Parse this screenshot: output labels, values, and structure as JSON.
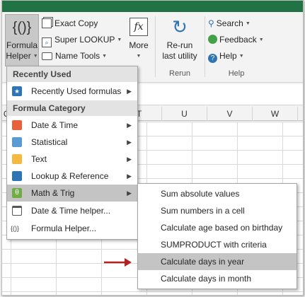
{
  "ribbon": {
    "formula_helper": {
      "line1": "Formula",
      "line2": "Helper",
      "icon": "{()}"
    },
    "exact_copy": "Exact Copy",
    "super_lookup": "Super LOOKUP",
    "name_tools": "Name Tools",
    "more": {
      "label": "More",
      "icon": "fx"
    },
    "rerun": {
      "line1": "Re-run",
      "line2": "last utility"
    },
    "search": "Search",
    "feedback": "Feedback",
    "help": "Help",
    "group_rerun": "Rerun",
    "group_help": "Help"
  },
  "columns": [
    "Q",
    "T",
    "U",
    "V",
    "W"
  ],
  "menu": {
    "recently_used_header": "Recently Used",
    "recently_used_item": "Recently Used formulas",
    "category_header": "Formula Category",
    "items": [
      {
        "label": "Date & Time",
        "icon": "clock-icon",
        "color": "#e8603c"
      },
      {
        "label": "Statistical",
        "icon": "chart-icon",
        "color": "#5b9bd5"
      },
      {
        "label": "Text",
        "icon": "text-icon",
        "color": "#f4b942"
      },
      {
        "label": "Lookup & Reference",
        "icon": "lookup-icon",
        "color": "#2e75b6"
      },
      {
        "label": "Math & Trig",
        "icon": "theta-icon",
        "color": "#70ad47"
      },
      {
        "label": "Date & Time helper...",
        "icon": "calendar-icon",
        "color": "#555555"
      },
      {
        "label": "Formula Helper...",
        "icon": "{()}",
        "color": "#555555"
      }
    ]
  },
  "submenu": {
    "items": [
      "Sum absolute values",
      "Sum numbers in a cell",
      "Calculate age based on birthday",
      "SUMPRODUCT with criteria",
      "Calculate days in year",
      "Calculate days in month"
    ],
    "highlighted_index": 4
  },
  "colors": {
    "excel_green": "#217346",
    "highlight": "#c4c4c4",
    "arrow": "#b22222"
  }
}
